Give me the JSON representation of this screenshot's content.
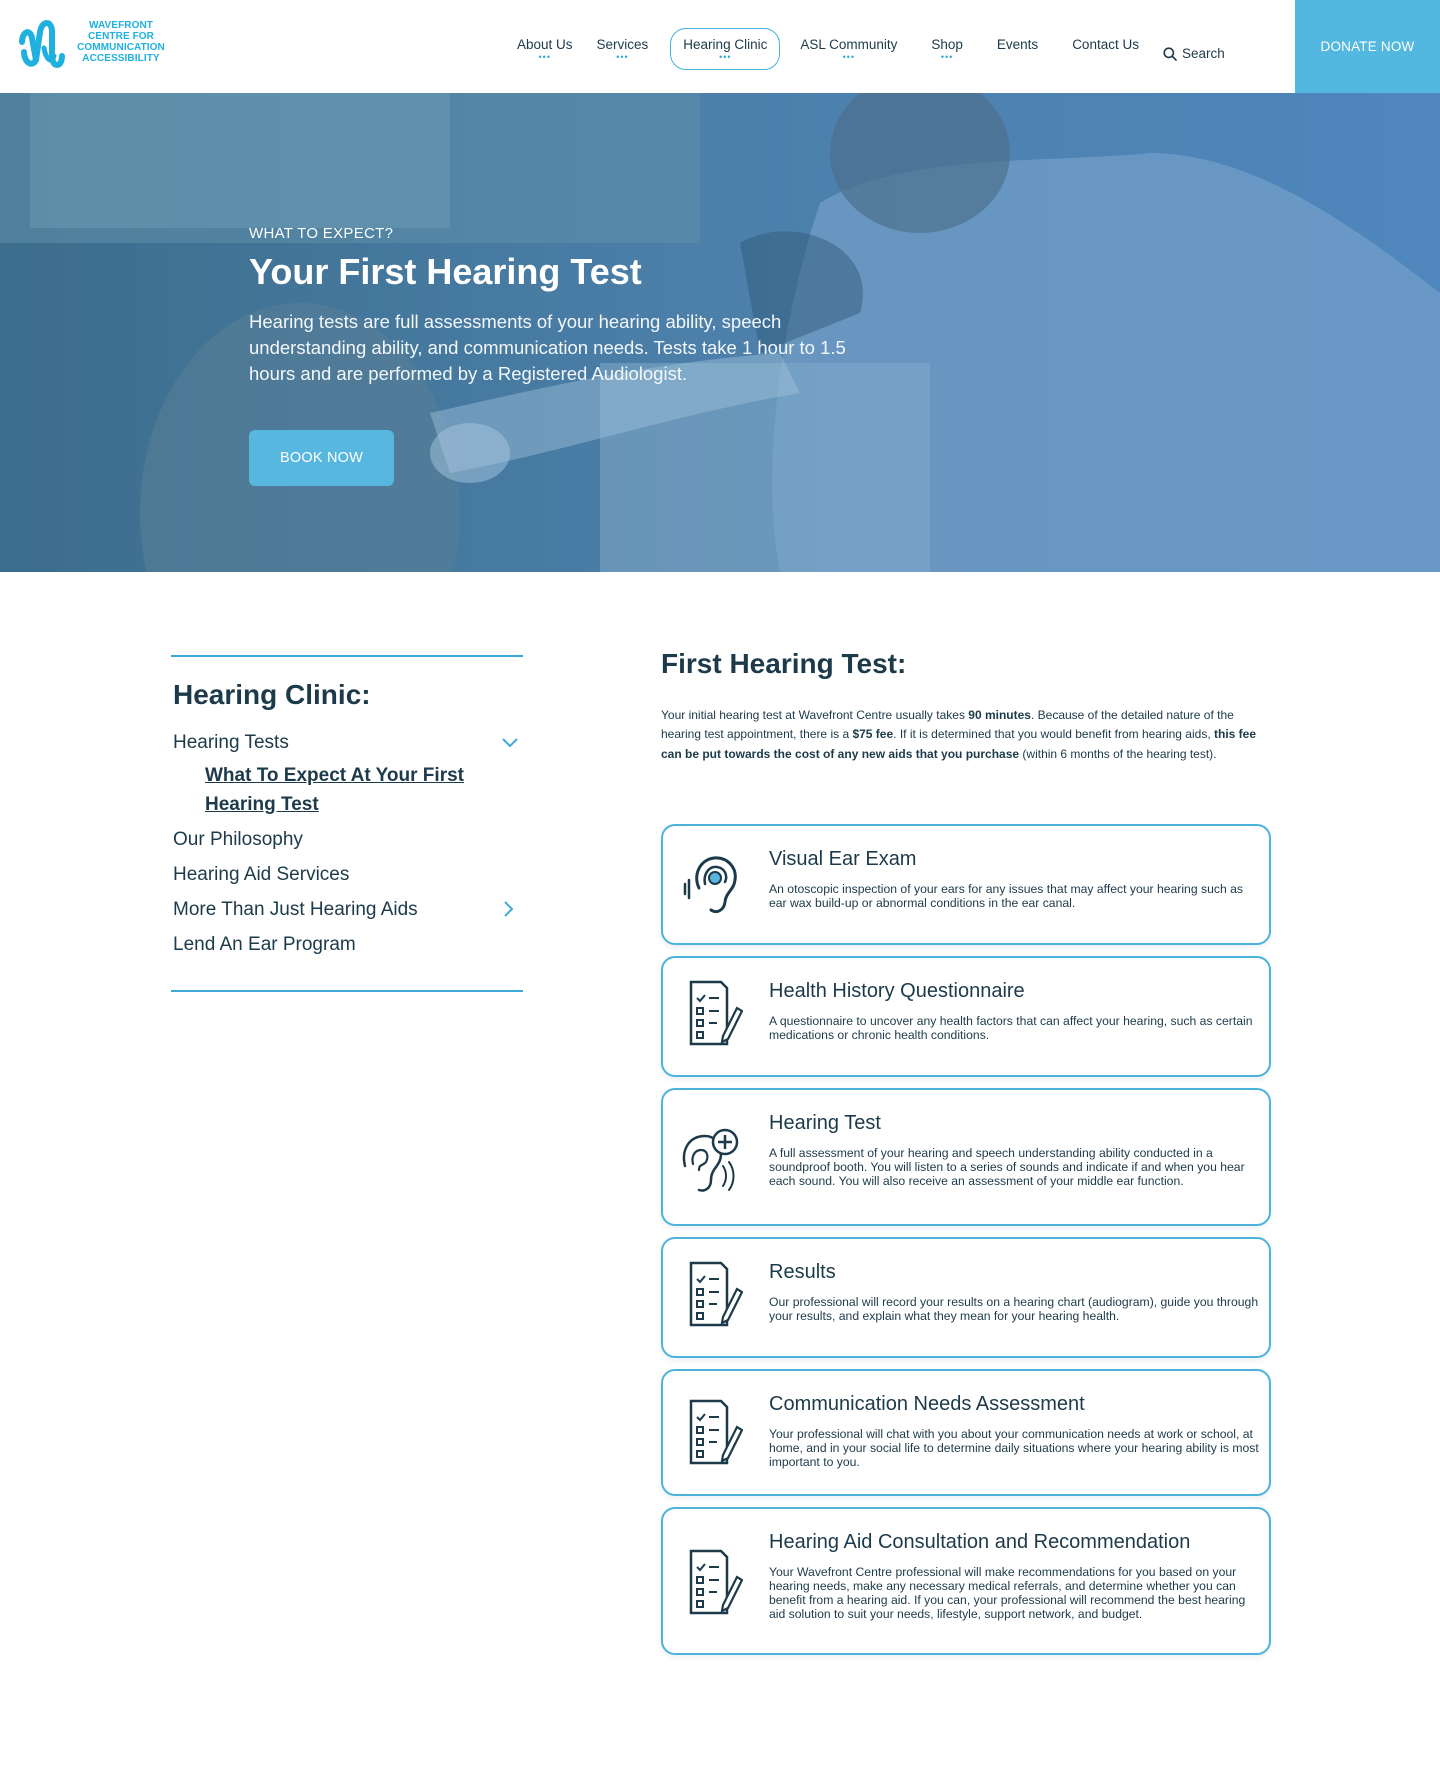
{
  "brand": {
    "line1": "WAVEFRONT",
    "line2": "CENTRE FOR",
    "line3": "COMMUNICATION",
    "line4": "ACCESSIBILITY",
    "color": "#1fb0e0"
  },
  "nav": {
    "items": [
      {
        "label": "About Us",
        "dots": "•••"
      },
      {
        "label": "Services",
        "dots": "•••"
      },
      {
        "label": "Hearing Clinic",
        "dots": "•••"
      },
      {
        "label": "ASL Community",
        "dots": "•••"
      },
      {
        "label": "Shop",
        "dots": "•••"
      },
      {
        "label": "Events",
        "dots": ""
      },
      {
        "label": "Contact Us",
        "dots": ""
      }
    ],
    "search_label": "Search",
    "donate_label": "DONATE NOW",
    "accent": "#53b8df"
  },
  "hero": {
    "eyebrow": "WHAT TO EXPECT?",
    "title": "Your First Hearing Test",
    "description": "Hearing tests are full assessments of your hearing ability, speech understanding ability, and communication needs. Tests take 1 hour to 1.5 hours and are performed by a Registered Audiologist.",
    "button_label": "BOOK NOW"
  },
  "sidebar": {
    "title": "Hearing Clinic:",
    "items": [
      {
        "label": "Hearing Tests"
      },
      {
        "label": "What To Expect At Your First Hearing Test"
      },
      {
        "label": "Our Philosophy"
      },
      {
        "label": "Hearing Aid Services"
      },
      {
        "label": "More Than Just Hearing Aids"
      },
      {
        "label": "Lend An Ear Program"
      }
    ]
  },
  "main": {
    "title": "First Hearing Test:",
    "intro": {
      "p1": "Your initial hearing test at Wavefront Centre usually takes ",
      "b1": "90 minutes",
      "p2": ". Because of the detailed nature of the hearing test appointment, there is a ",
      "b2": "$75 fee",
      "p3": ". If it is determined that you would benefit from hearing aids, ",
      "b3": "this fee can be put towards the cost of any new aids that you purchase",
      "p4": " (within 6 months of the hearing test)."
    },
    "cards": [
      {
        "title": "Visual Ear Exam",
        "icon": "ear-icon",
        "text": "An otoscopic inspection of your ears for any issues that may affect your hearing such as ear wax build-up or abnormal conditions in the ear canal."
      },
      {
        "title": "Health History Questionnaire",
        "icon": "checklist-icon",
        "text": "A questionnaire to uncover any health factors that can affect your hearing, such as certain medications or chronic health conditions."
      },
      {
        "title": "Hearing Test",
        "icon": "hearing-test-icon",
        "text": "A full assessment of your hearing and speech understanding ability conducted in a soundproof booth. You will listen to a series of sounds and indicate if and when you hear each sound. You will also receive an assessment of your middle ear function."
      },
      {
        "title": "Results",
        "icon": "checklist-icon",
        "text": "Our professional will record your results on a hearing chart (audiogram), guide you through your results, and explain what they mean for your hearing health."
      },
      {
        "title": "Communication Needs Assessment",
        "icon": "checklist-icon",
        "text": "Your professional will chat with you about your communication needs at work or school, at home, and in your social life to determine daily situations where your hearing ability is most important to you."
      },
      {
        "title": "Hearing Aid Consultation and Recommendation",
        "icon": "checklist-icon",
        "text": "Your Wavefront Centre professional will make recommendations for you based on your hearing needs, make any necessary medical referrals, and determine whether you can benefit from a hearing aid. If you can, your professional will recommend the best hearing aid solution to suit your needs, lifestyle, support network, and budget."
      }
    ]
  }
}
